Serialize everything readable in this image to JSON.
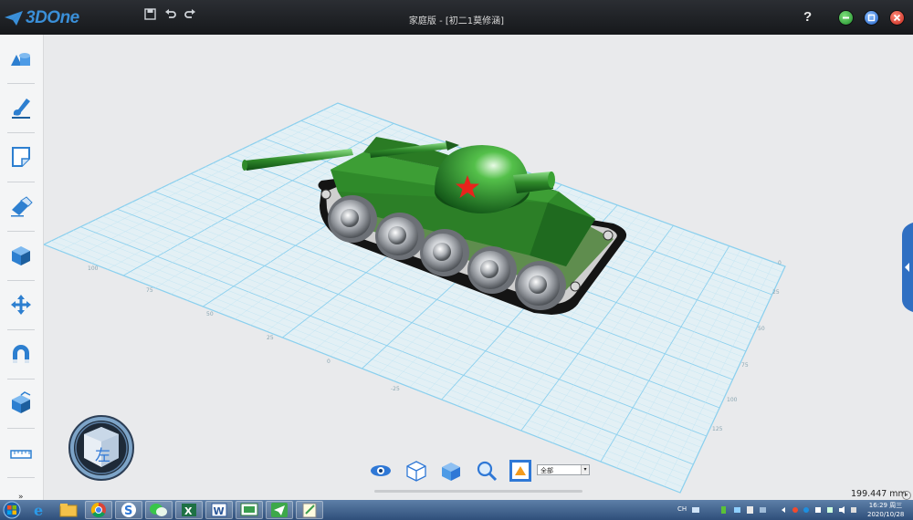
{
  "app": {
    "name": "3DOne",
    "title": "家庭版 - [初二1莫修涵]",
    "help": "?"
  },
  "quick_access": [
    {
      "name": "save-icon"
    },
    {
      "name": "undo-icon"
    },
    {
      "name": "redo-icon"
    }
  ],
  "window_buttons": [
    {
      "name": "minimize-button",
      "color": "#2fae3a"
    },
    {
      "name": "maximize-button",
      "color": "#2f78d6"
    },
    {
      "name": "close-button",
      "color": "#d93a2e"
    }
  ],
  "left_tools": [
    {
      "name": "basic-shape-tool",
      "icon": "shapes-icon"
    },
    {
      "name": "sketch-draw-tool",
      "icon": "pen-icon"
    },
    {
      "name": "sketch-edit-tool",
      "icon": "sketch-edit-icon"
    },
    {
      "name": "special-feature-tool",
      "icon": "eraser-icon"
    },
    {
      "name": "solid-edit-tool",
      "icon": "cube-icon"
    },
    {
      "name": "move-tool",
      "icon": "move-arrows-icon"
    },
    {
      "name": "combine-tool",
      "icon": "magnet-icon"
    },
    {
      "name": "pattern-tool",
      "icon": "box-open-icon"
    },
    {
      "name": "distance-measure-tool",
      "icon": "ruler-icon"
    }
  ],
  "more_tools": "»",
  "navcube": {
    "face_label": "左"
  },
  "view_tools": [
    {
      "name": "display-toggle-button",
      "icon": "eye-icon"
    },
    {
      "name": "wireframe-view-button",
      "icon": "wire-cube-icon"
    },
    {
      "name": "shaded-view-button",
      "icon": "solid-cube-icon"
    },
    {
      "name": "zoom-fit-button",
      "icon": "magnifier-icon"
    },
    {
      "name": "render-button",
      "icon": "render-icon"
    }
  ],
  "filter": {
    "value": "全部"
  },
  "measurement": "199.447 mm",
  "taskbar": {
    "apps": [
      {
        "name": "start-button",
        "icon": "windows-logo-icon"
      },
      {
        "name": "taskbar-ie",
        "icon": "ie-icon"
      },
      {
        "name": "taskbar-explorer",
        "icon": "folder-icon"
      },
      {
        "name": "taskbar-chrome",
        "icon": "chrome-icon"
      },
      {
        "name": "taskbar-sogou",
        "icon": "sogou-icon"
      },
      {
        "name": "taskbar-wechat",
        "icon": "wechat-icon"
      },
      {
        "name": "taskbar-excel",
        "icon": "excel-icon"
      },
      {
        "name": "taskbar-word",
        "icon": "word-icon"
      },
      {
        "name": "taskbar-presentation",
        "icon": "presentation-icon"
      },
      {
        "name": "taskbar-3done",
        "icon": "3done-icon"
      },
      {
        "name": "taskbar-notepad",
        "icon": "notepad-icon"
      }
    ],
    "tray_lang": "CH",
    "time": "16:29 周三",
    "date": "2020/10/28"
  },
  "grid_color": "#7fc7e8",
  "tank_color": "#2f8a2a"
}
